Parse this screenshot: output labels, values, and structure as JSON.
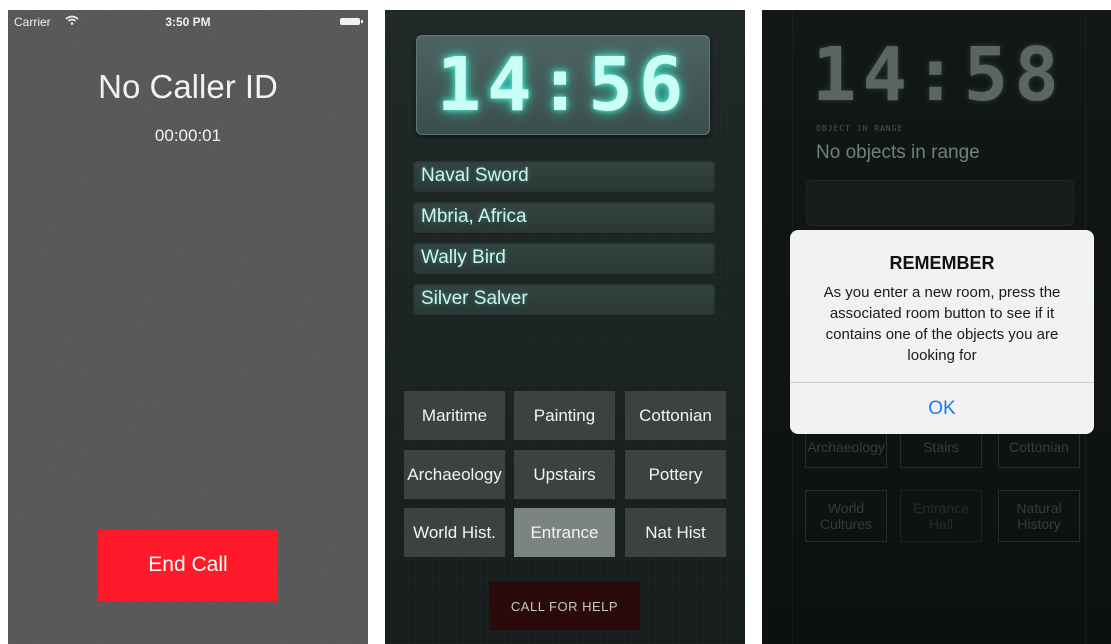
{
  "call_screen": {
    "status_bar": {
      "carrier": "Carrier",
      "time": "3:50 PM"
    },
    "caller": "No Caller ID",
    "duration": "00:00:01",
    "end_call_label": "End Call",
    "end_call_color": "#fe1a2a"
  },
  "checklist_screen": {
    "clock": "14:56",
    "objects": [
      "Naval Sword",
      "Mbria, Africa",
      "Wally Bird",
      "Silver Salver"
    ],
    "rooms": [
      "Maritime",
      "Painting",
      "Cottonian",
      "Archaeology",
      "Upstairs",
      "Pottery",
      "World Hist.",
      "Entrance",
      "Nat Hist"
    ],
    "active_room": "Entrance",
    "help_label": "CALL FOR HELP"
  },
  "alert_screen": {
    "clock": "14:58",
    "range_label": "OBJECT IN RANGE",
    "range_value": "No objects in range",
    "background_rooms": [
      "Archaeology",
      "Stairs",
      "Cottonian",
      "World Cultures",
      "Entrance Hall",
      "Natural History"
    ],
    "alert": {
      "title": "REMEMBER",
      "message": "As you enter a new room, press the associated room button to see if it contains one of the objects you are looking for",
      "button": "OK"
    }
  }
}
